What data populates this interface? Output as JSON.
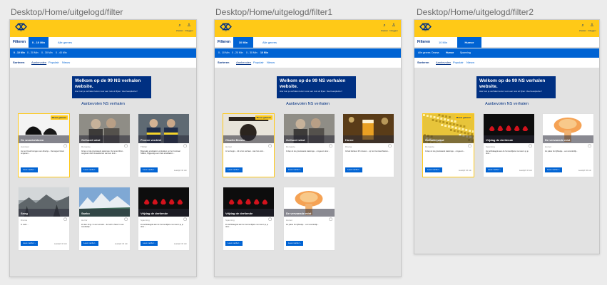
{
  "frames": [
    {
      "title": "Desktop/Home/uitgelogd/filter",
      "filter_tabs": [
        {
          "label": "0 - 10 Min",
          "selected": true
        },
        {
          "label": "Alle genres",
          "selected": false
        }
      ],
      "sub_options": [
        "0 - 10 Min",
        "0 - 20 Min",
        "0 - 30 Min",
        "0 - 40 Min"
      ],
      "cards": [
        {
          "title": "De wonderbloem",
          "category": "Avontuur",
          "badge": "Meest gelezen",
          "highlight": true,
          "img": "shoes",
          "text": "Jan en Duuk brengen een dinertje... De kapper bloeit omgeven...",
          "rating": ""
        },
        {
          "title": "Gelhoeri wind",
          "category": "Romance",
          "badge": "",
          "highlight": false,
          "img": "men",
          "text": "Ik liep uit de grootsteeds stationsje. De lente blinkt... omgeven door de aankomst van een trein...",
          "rating": ""
        },
        {
          "title": "Proeve verdriet",
          "category": "Thriller",
          "badge": "",
          "highlight": false,
          "img": "police",
          "text": "Bijgevalle eindstation vertrekken op het Centraal Station, Bijgevolge een hele eindstation...",
          "rating": "Leestijd: 10 min"
        },
        {
          "title": "Sneg",
          "category": "Drama",
          "badge": "",
          "highlight": false,
          "img": "snow",
          "text": "In melk ...",
          "rating": "Leestijd: 10 min"
        },
        {
          "title": "Saeko",
          "category": "Horror",
          "badge": "",
          "highlight": false,
          "img": "mountain",
          "text": "Ze kan zingt. In een wonder... de lucht. Zeker in een wonderlijk...",
          "rating": "Leestijd: 10 min"
        },
        {
          "title": "Vrijdag de dertiende",
          "category": "Spanning",
          "badge": "",
          "highlight": false,
          "img": "friday",
          "text": "Ze lachtdaagde aan de hunnenlijkste met wenn je je door ...",
          "rating": "Leestijd: 10 min"
        }
      ]
    },
    {
      "title": "Desktop/Home/uitgelogd/filter1",
      "filter_tabs": [
        {
          "label": "10 Min",
          "selected": true
        },
        {
          "label": "Alle genres",
          "selected": false
        }
      ],
      "sub_options": [
        "0 - 10 Min",
        "0 - 20 Min",
        "0 - 30 Min",
        "10 Min"
      ],
      "cards": [
        {
          "title": "Charlie Brown",
          "category": "Humor",
          "badge": "Meest gelezen",
          "highlight": true,
          "img": "winning",
          "text": "In het begin... dit is het verhaal... Aan het eind...",
          "rating": ""
        },
        {
          "title": "Gelhoeri wind",
          "category": "Romance",
          "badge": "",
          "highlight": false,
          "img": "men",
          "text": "Ik liep uit de grootsteeds stationsje... omgeven door...",
          "rating": ""
        },
        {
          "title": "Horne",
          "category": "Drama",
          "badge": "",
          "highlight": false,
          "img": "beer",
          "text": "Ik had behalve 35 minuten... op het Centraal Station...",
          "rating": ""
        },
        {
          "title": "Vrijdag de dertiende",
          "category": "Spanning",
          "badge": "",
          "highlight": false,
          "img": "friday",
          "text": "Ze lachtdaagde aan de hunnenlijkste met wenn je je door...",
          "rating": ""
        },
        {
          "title": "De vervaende mist",
          "category": "Humor",
          "badge": "",
          "highlight": false,
          "img": "mushroom",
          "text": "Ze pakte het lijfstukje... een wonderlijk...",
          "rating": ""
        }
      ]
    },
    {
      "title": "Desktop/Home/uitgelogd/filter2",
      "filter_tabs": [
        {
          "label": "10 Min",
          "selected": false
        },
        {
          "label": "Humor",
          "selected": true
        }
      ],
      "sub_options": [
        "Alle genres",
        "Drama",
        "Humor",
        "Spanning"
      ],
      "cards": [
        {
          "title": "Gelhoeri wind",
          "category": "Romance",
          "badge": "Meest gelezen",
          "highlight": true,
          "img": "noise",
          "text": "Ik liep uit de grootsteeds stationsje... omgeven...",
          "rating": "Leestijd: 10 min"
        },
        {
          "title": "Vrijdag de dertiende",
          "category": "Spanning",
          "badge": "",
          "highlight": false,
          "img": "friday",
          "text": "Ze lachtdaagde aan de hunnenlijkste met wenn je je door...",
          "rating": "Leestijd: 10 min"
        },
        {
          "title": "De vervaende mist",
          "category": "Humor",
          "badge": "",
          "highlight": false,
          "img": "mushroom",
          "text": "Ze pakte het lijfstukje... een wonderlijk...",
          "rating": "Leestijd: 10 min"
        }
      ]
    }
  ],
  "common": {
    "logo_text": "NS",
    "search_label": "Zoeken",
    "login_label": "Inloggen",
    "filter_label": "Filteren",
    "sort_label": "Sorteren",
    "sort_options": [
      "Aanbevolen",
      "Populair",
      "Nieuw"
    ],
    "sort_selected": "Aanbevolen",
    "hero_title": "Welkom op de 99 NS verhalen website.",
    "hero_subtitle": "Hier kun je verhalen lezen voor een reis uit fijner. Veel leesplezier!",
    "section_title": "Aanbevolen NS verhalen",
    "read_more": "Lees verder",
    "bookmark_glyph": "▢",
    "search_glyph": "⌕",
    "user_glyph": "♙",
    "colors": {
      "yellow": "#ffc917",
      "blue": "#0063d3",
      "navy": "#003082"
    }
  }
}
